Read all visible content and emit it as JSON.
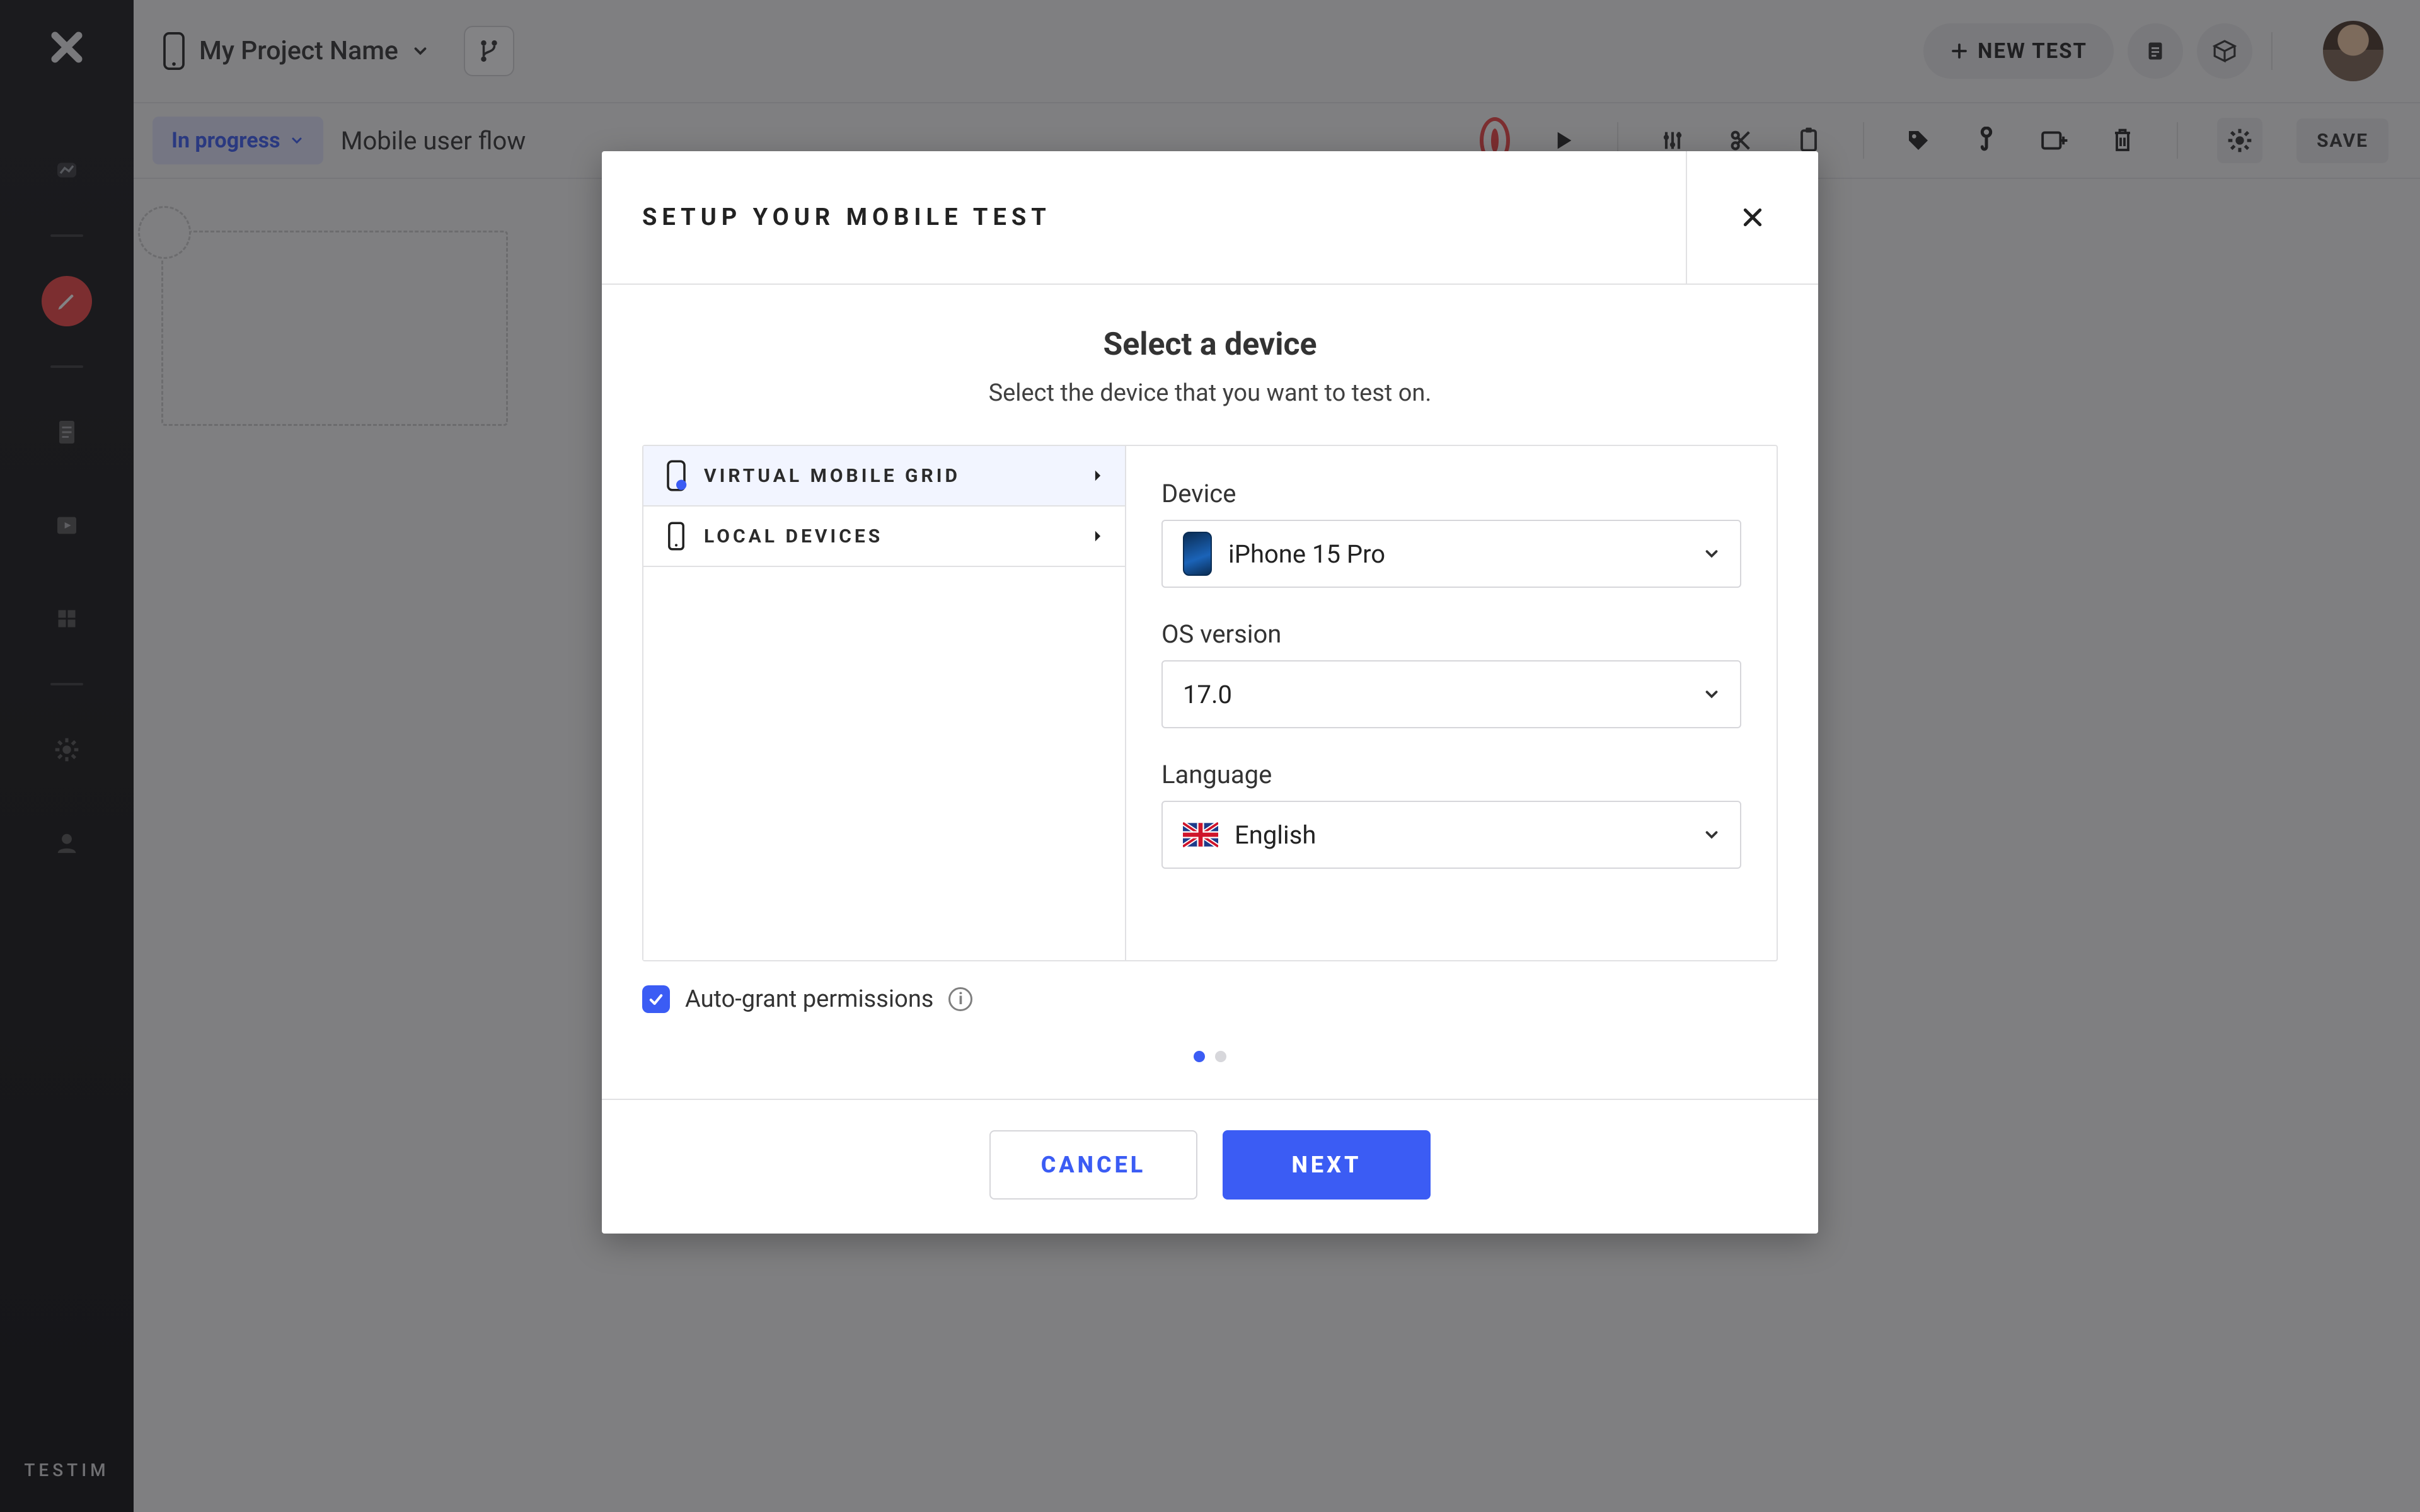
{
  "brand": "TESTIM",
  "topbar": {
    "project_name": "My Project Name",
    "new_test_label": "NEW TEST"
  },
  "subbar": {
    "status_label": "In progress",
    "flow_name": "Mobile user flow",
    "save_label": "SAVE"
  },
  "modal": {
    "title": "SETUP YOUR MOBILE TEST",
    "heading": "Select a device",
    "subheading": "Select the device that you want to test on.",
    "sources": {
      "virtual_grid": "VIRTUAL MOBILE GRID",
      "local_devices": "LOCAL DEVICES"
    },
    "fields": {
      "device_label": "Device",
      "device_value": "iPhone 15 Pro",
      "os_label": "OS version",
      "os_value": "17.0",
      "lang_label": "Language",
      "lang_value": "English"
    },
    "auto_grant_label": "Auto-grant permissions",
    "footer": {
      "cancel": "CANCEL",
      "next": "NEXT"
    }
  }
}
